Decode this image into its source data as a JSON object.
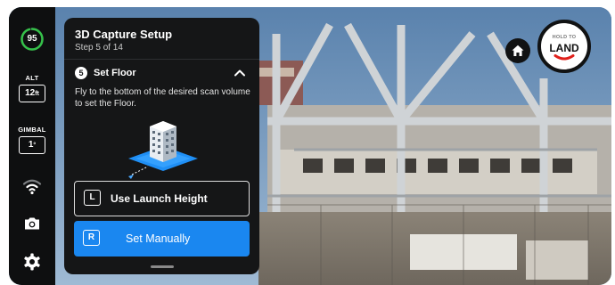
{
  "status": {
    "battery_percent": "95",
    "battery_level": 0.95,
    "alt_label": "ALT",
    "alt_value": "12",
    "alt_unit": "ft",
    "gimbal_label": "GIMBAL",
    "gimbal_value": "1",
    "gimbal_unit": "°"
  },
  "panel": {
    "title": "3D Capture Setup",
    "step_progress": "Step 5 of 14",
    "step_number": "5",
    "step_title": "Set Floor",
    "instructions": "Fly to the bottom of the desired scan volume to set the Floor.",
    "launch_key": "L",
    "launch_label": "Use Launch Height",
    "manual_key": "R",
    "manual_label": "Set Manually"
  },
  "controls": {
    "land_top": "HOLD TO",
    "land_main": "LAND"
  },
  "colors": {
    "accent": "#1a87f0",
    "battery": "#35c14a",
    "land": "#e0201b",
    "panel_bg": "#151617"
  },
  "icons": {
    "rail": [
      "wifi-signal-icon",
      "camera-icon",
      "gear-icon"
    ],
    "panel": [
      "chevron-up-icon",
      "scan-volume-building-icon"
    ],
    "right": [
      "home-icon",
      "land-arc-icon"
    ]
  }
}
